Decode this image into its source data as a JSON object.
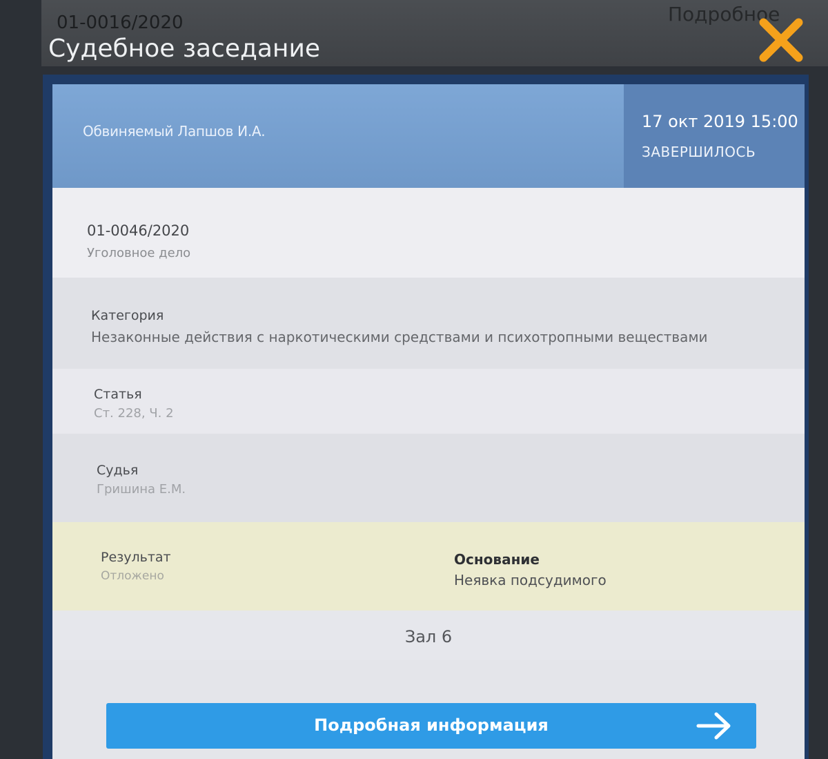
{
  "background": {
    "case_number": "01-0016/2020",
    "title": "Судебное заседание",
    "more_label": "Подробное"
  },
  "card": {
    "defendant": "Обвиняемый Лапшов И.А.",
    "datetime": "17 окт 2019 15:00",
    "status": "ЗАВЕРШИЛОСЬ",
    "case_number": "01-0046/2020",
    "case_type": "Уголовное дело",
    "category_label": "Категория",
    "category_value": "Незаконные действия с наркотическими средствами и психотропными веществами",
    "article_label": "Статья",
    "article_value": "Ст. 228, Ч. 2",
    "judge_label": "Судья",
    "judge_value": "Гришина Е.М.",
    "result_label": "Результат",
    "result_value": "Отложено",
    "basis_label": "Основание",
    "basis_value": "Неявка подсудимого",
    "hall": "Зал 6",
    "details_button": "Подробная информация"
  },
  "icons": {
    "close": "close-icon",
    "arrow": "arrow-right-icon"
  },
  "colors": {
    "accent_close": "#f5a11b",
    "header_blue": "#7ea7d6",
    "status_blue": "#5c83b6",
    "result_yellow": "#ecebcf",
    "button_blue": "#2f9be6"
  }
}
